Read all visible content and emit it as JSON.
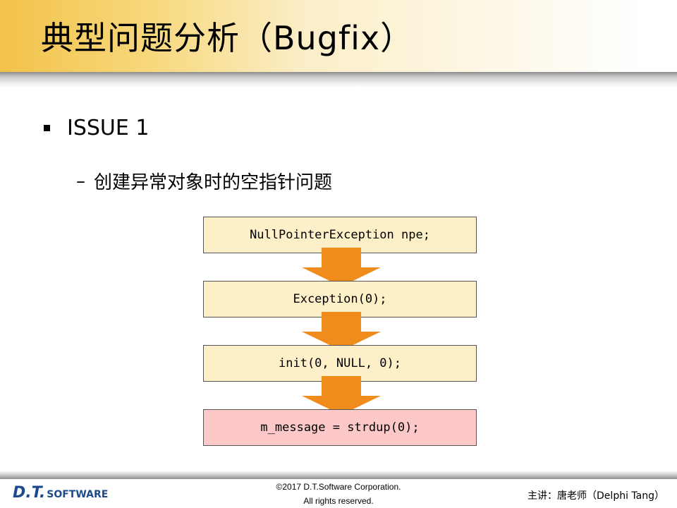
{
  "title": "典型问题分析（Bugfix）",
  "bullet": {
    "text": "ISSUE 1",
    "sub": "创建异常对象时的空指针问题"
  },
  "flow": {
    "steps": [
      "NullPointerException npe;",
      "Exception(0);",
      "init(0, NULL, 0);",
      "m_message = strdup(0);"
    ],
    "colors": {
      "box": "#fdf0c8",
      "highlight": "#fcc8c8",
      "arrow": "#f08c1c"
    }
  },
  "footer": {
    "logo_main": "D.T.",
    "logo_sub": "SOFTWARE",
    "copyright_line1": "©2017 D.T.Software Corporation.",
    "copyright_line2": "All rights reserved.",
    "lecturer": "主讲：唐老师（Delphi Tang）"
  }
}
